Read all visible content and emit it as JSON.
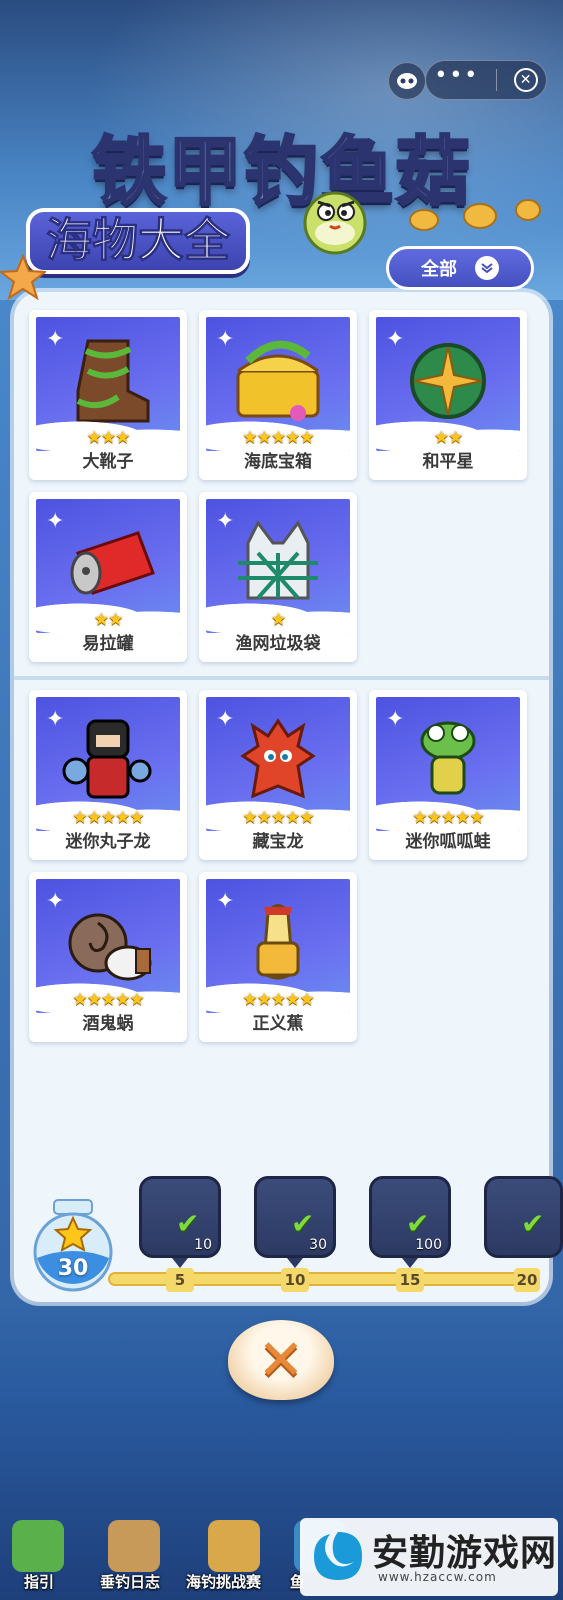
{
  "header": {
    "game_title": "铁甲钓鱼菇",
    "panel_title": "海物大全",
    "filter_label": "全部"
  },
  "groups": [
    {
      "items": [
        {
          "name": "大靴子",
          "stars": 3
        },
        {
          "name": "海底宝箱",
          "stars": 5
        },
        {
          "name": "和平星",
          "stars": 2
        },
        {
          "name": "易拉罐",
          "stars": 2
        },
        {
          "name": "渔网垃圾袋",
          "stars": 1
        }
      ]
    },
    {
      "items": [
        {
          "name": "迷你丸子龙",
          "stars": 5
        },
        {
          "name": "藏宝龙",
          "stars": 5
        },
        {
          "name": "迷你呱呱蛙",
          "stars": 5
        },
        {
          "name": "酒鬼蜗",
          "stars": 5
        },
        {
          "name": "正义蕉",
          "stars": 5
        }
      ]
    }
  ],
  "progress": {
    "star_count": "30",
    "milestones": [
      "5",
      "10",
      "15",
      "20"
    ],
    "rewards": [
      {
        "amount": "10",
        "icon": "ticket-icon"
      },
      {
        "amount": "30",
        "icon": "key-icon"
      },
      {
        "amount": "100",
        "icon": "hammer-icon"
      },
      {
        "amount": "",
        "icon": "reward-icon"
      }
    ]
  },
  "bottom_nav": {
    "items": [
      "指引",
      "垂钓日志",
      "海钓挑战赛",
      "鱼"
    ]
  },
  "watermark": {
    "name": "安勤游戏网",
    "url": "www.hzaccw.com"
  },
  "colors": {
    "card_art_bg": "#5a5fe8",
    "star": "#ffc61a",
    "panel_bg": "#eef5fb",
    "close_x": "#e8893a"
  }
}
